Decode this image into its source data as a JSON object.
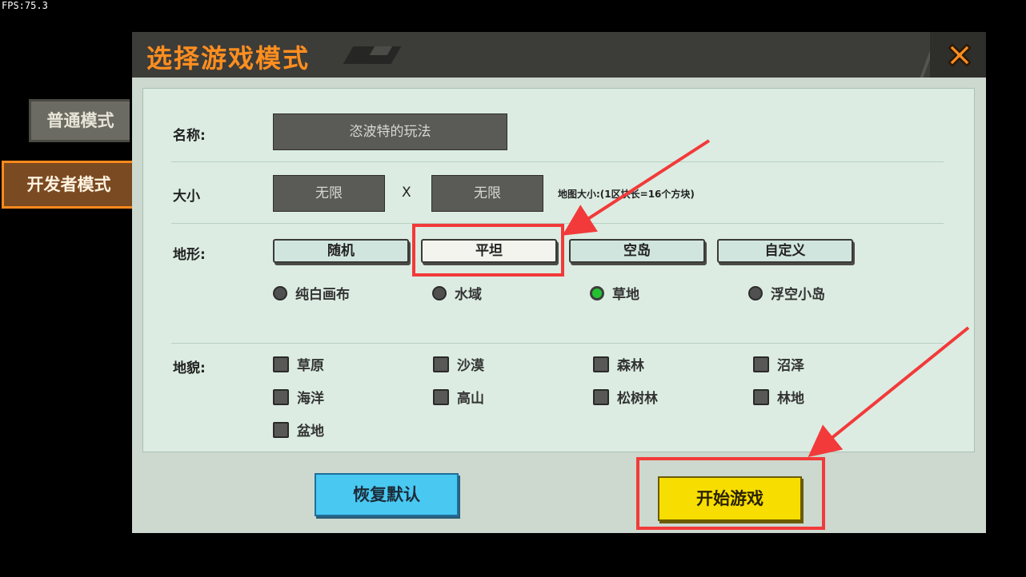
{
  "fps": "FPS:75.3",
  "side_tabs": {
    "normal": "普通模式",
    "developer": "开发者模式"
  },
  "dialog": {
    "title": "选择游戏模式"
  },
  "form": {
    "name_label": "名称:",
    "name_value": "恣波特的玩法",
    "size_label": "大小",
    "size_width": "无限",
    "size_x": "X",
    "size_height": "无限",
    "size_note": "地图大小:(1区块长=16个方块)",
    "terrain_label": "地形:",
    "terrain_buttons": [
      "随机",
      "平坦",
      "空岛",
      "自定义"
    ],
    "terrain_selected": "平坦",
    "surface_options": [
      "纯白画布",
      "水域",
      "草地",
      "浮空小岛"
    ],
    "surface_selected": "草地",
    "landform_label": "地貌:",
    "landforms": [
      "草原",
      "沙漠",
      "森林",
      "沼泽",
      "海洋",
      "高山",
      "松树林",
      "林地",
      "盆地"
    ]
  },
  "buttons": {
    "reset": "恢复默认",
    "start": "开始游戏"
  },
  "colors": {
    "accent_orange": "#ff8e1f",
    "start_yellow": "#f8de00",
    "reset_blue": "#49c9f2",
    "annotation_red": "#f23a3a"
  }
}
